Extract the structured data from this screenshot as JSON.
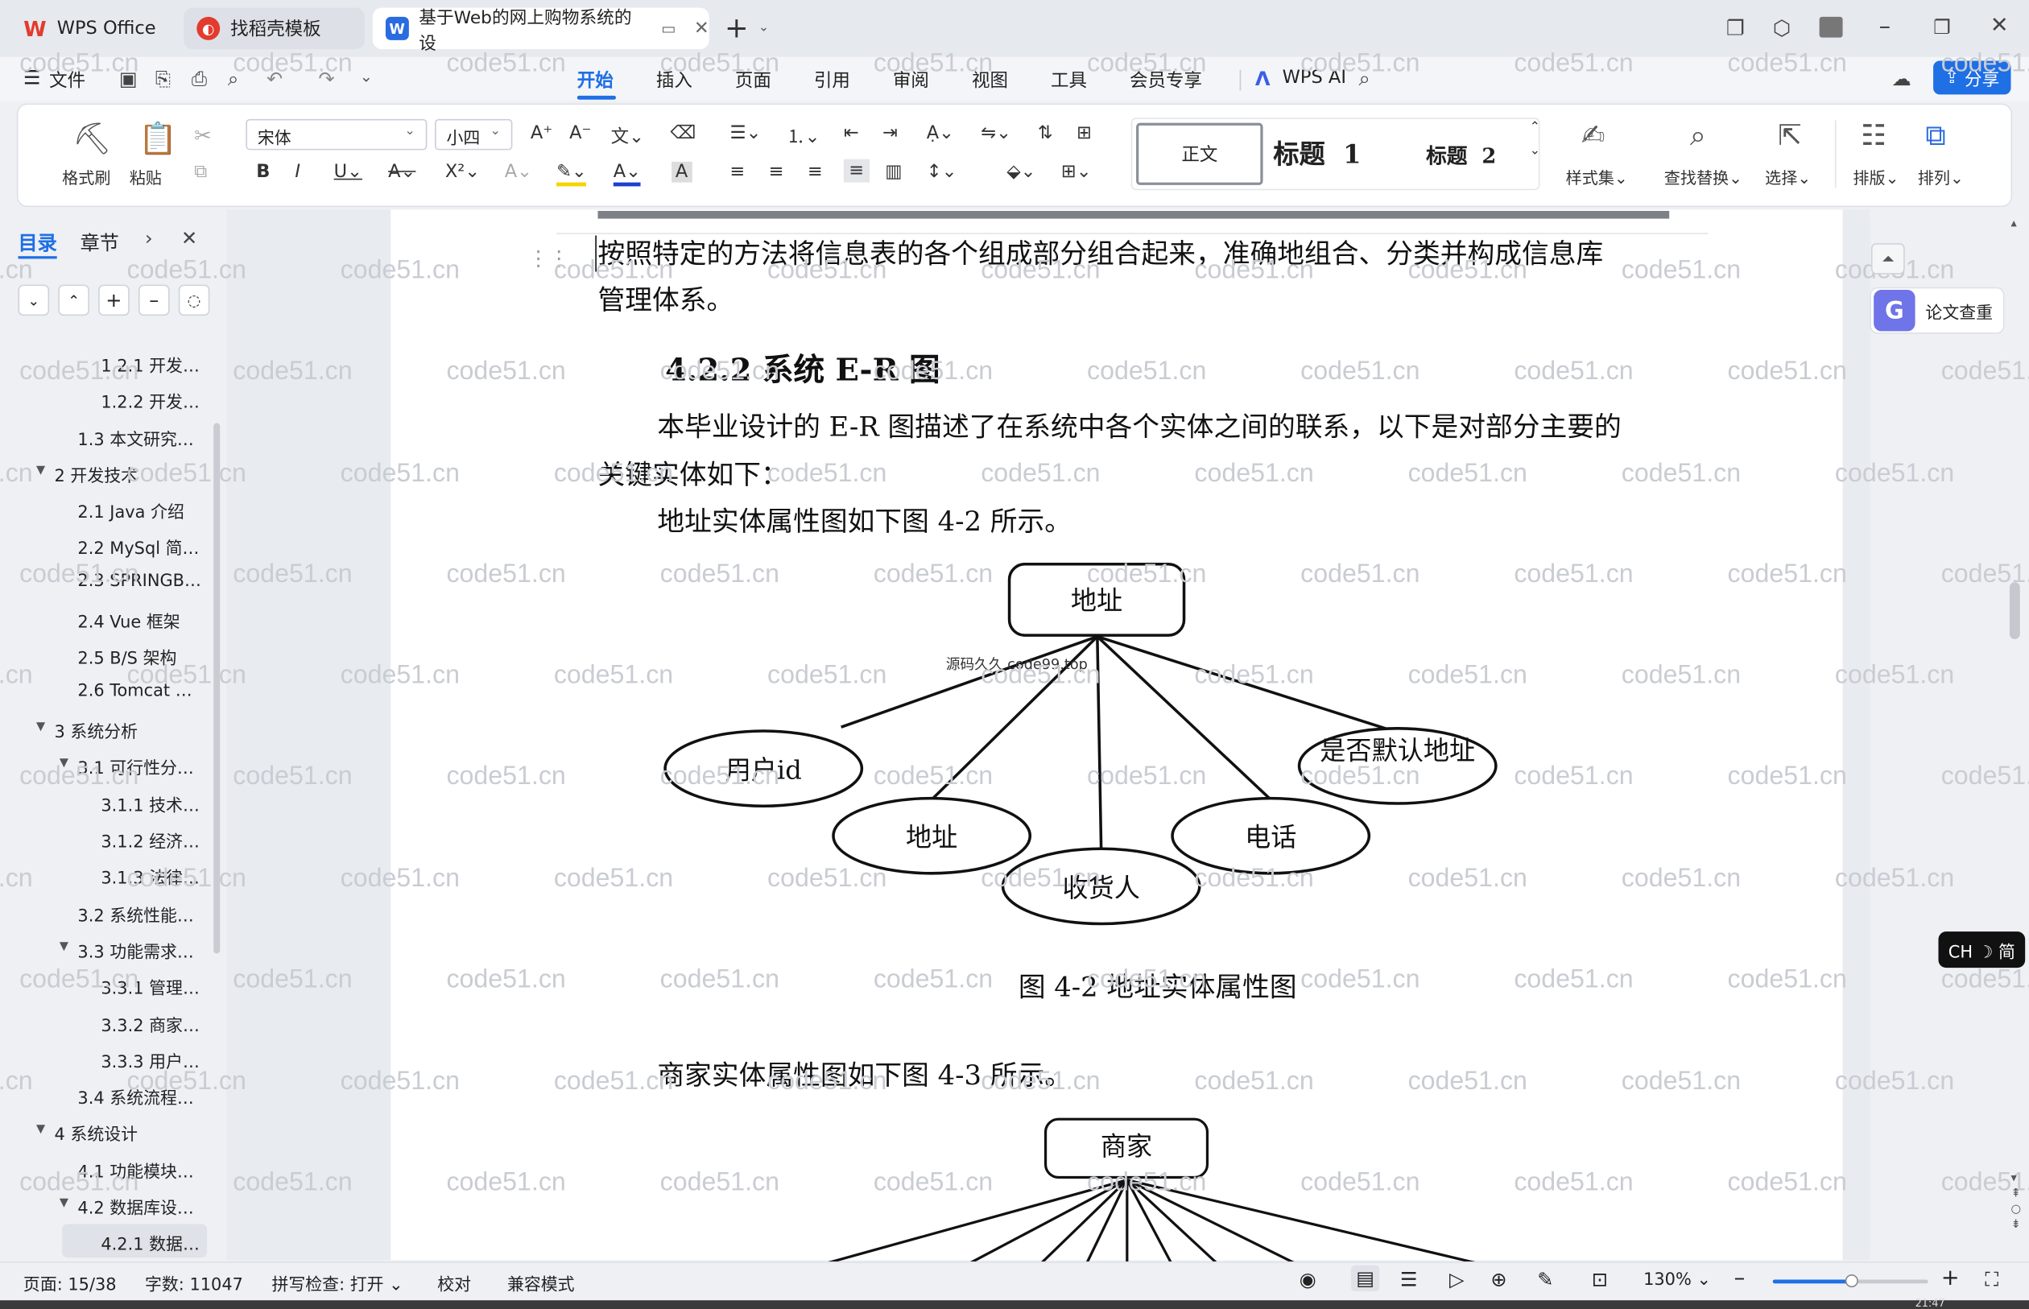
{
  "tabs": [
    {
      "label": "WPS Office"
    },
    {
      "label": "找稻壳模板"
    },
    {
      "label": "基于Web的网上购物系统的设"
    }
  ],
  "menu": {
    "file": "文件",
    "tabs": [
      "开始",
      "插入",
      "页面",
      "引用",
      "审阅",
      "视图",
      "工具",
      "会员专享"
    ],
    "active": "开始",
    "wps_ai": "WPS AI",
    "share": "分享"
  },
  "ribbon": {
    "format_painter": "格式刷",
    "paste": "粘贴",
    "font_name": "宋体",
    "font_size": "小四",
    "style_normal": "正文",
    "style_h1": "标题  1",
    "style_h2": "标题  2",
    "style_set": "样式集",
    "find_replace": "查找替换",
    "select": "选择",
    "layout": "排版",
    "arrange": "排列"
  },
  "sidebar": {
    "tab_toc": "目录",
    "tab_section": "章节",
    "items": [
      {
        "label": "1.2.1 开发…",
        "level": 3
      },
      {
        "label": "1.2.2 开发…",
        "level": 3
      },
      {
        "label": "1.3 本文研究…",
        "level": 2
      },
      {
        "label": "2 开发技术",
        "level": 1
      },
      {
        "label": "2.1 Java 介绍",
        "level": 2
      },
      {
        "label": "2.2 MySql 简…",
        "level": 2
      },
      {
        "label": "2.3 SPRINGB…",
        "level": 2
      },
      {
        "label": "2.4 Vue 框架",
        "level": 2
      },
      {
        "label": "2.5 B/S 架构",
        "level": 2
      },
      {
        "label": "2.6 Tomcat …",
        "level": 2
      },
      {
        "label": "3 系统分析",
        "level": 1
      },
      {
        "label": "3.1 可行性分…",
        "level": 2
      },
      {
        "label": "3.1.1 技术…",
        "level": 3
      },
      {
        "label": "3.1.2 经济…",
        "level": 3
      },
      {
        "label": "3.1.3 法律…",
        "level": 3
      },
      {
        "label": "3.2 系统性能…",
        "level": 2
      },
      {
        "label": "3.3 功能需求…",
        "level": 2
      },
      {
        "label": "3.3.1 管理…",
        "level": 3
      },
      {
        "label": "3.3.2 商家…",
        "level": 3
      },
      {
        "label": "3.3.3 用户…",
        "level": 3
      },
      {
        "label": "3.4 系统流程…",
        "level": 2
      },
      {
        "label": "4 系统设计",
        "level": 1
      },
      {
        "label": "4.1 功能模块…",
        "level": 2
      },
      {
        "label": "4.2 数据库设…",
        "level": 2
      },
      {
        "label": "4.2.1 数据…",
        "level": 3
      }
    ]
  },
  "document": {
    "para1_line1": "按照特定的方法将信息表的各个组成部分组合起来，准确地组合、分类并构成信息库",
    "para1_line2": "管理体系。",
    "heading": "4.2.2 系统 E-R 图",
    "para2_line1": "本毕业设计的 E-R 图描述了在系统中各个实体之间的联系，以下是对部分主要的",
    "para2_line2": "关键实体如下：",
    "para3": "地址实体属性图如下图 4-2 所示。",
    "watermark_small": "源码久久 code99.top",
    "er1": {
      "entity": "地址",
      "attributes": [
        "用户id",
        "地址",
        "收货人",
        "电话",
        "是否默认地址"
      ]
    },
    "caption1": "图 4-2 地址实体属性图",
    "para4": "商家实体属性图如下图 4-3 所示。",
    "er2": {
      "entity": "商家"
    }
  },
  "right_panel": {
    "paper_check": "论文查重",
    "ime": "CH ☽ 简"
  },
  "watermark": "code51.cn",
  "status": {
    "page": "页面: 15/38",
    "words": "字数: 11047",
    "spell": "拼写检查: 打开",
    "proof": "校对",
    "compat": "兼容模式",
    "zoom": "130%",
    "time": "21:47"
  },
  "colors": {
    "accent": "#1f6fe5",
    "wps_red": "#e33b2e",
    "tab_active_bg": "#ffffff"
  }
}
